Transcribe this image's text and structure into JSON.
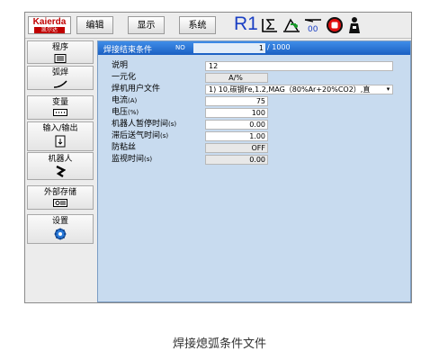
{
  "toolbar": {
    "logo_text": "Kaierda",
    "logo_sub": "凯尔达",
    "buttons": [
      "编辑",
      "显示",
      "系统"
    ],
    "robot_id": "R1",
    "icons": [
      "sigma-axis-icon",
      "arc-weld-icon",
      "percent-override-icon",
      "stop-icon",
      "person-icon"
    ]
  },
  "sidebar": {
    "items": [
      {
        "label": "程序",
        "icon": "program-icon"
      },
      {
        "label": "弧焊",
        "icon": "arc-icon"
      },
      {
        "label": "变量",
        "icon": "variable-icon"
      },
      {
        "label": "输入/输出",
        "icon": "io-icon"
      },
      {
        "label": "机器人",
        "icon": "robot-icon"
      },
      {
        "label": "外部存储",
        "icon": "storage-icon"
      },
      {
        "label": "设置",
        "icon": "settings-icon"
      }
    ]
  },
  "panel": {
    "title": "焊接结束条件",
    "no_label": "NO",
    "current_no": "1",
    "total": "/ 1000",
    "fields": [
      {
        "label": "说明",
        "unit": "",
        "value": "12"
      },
      {
        "label": "一元化",
        "unit": "",
        "value": "A/%"
      },
      {
        "label": "焊机用户文件",
        "unit": "",
        "value": "1) 10,碳钢Fe,1.2,MAG（80%Ar+20%CO2）,直"
      },
      {
        "label": "电流",
        "unit": "(A)",
        "value": "75"
      },
      {
        "label": "电压",
        "unit": "(%)",
        "value": "100"
      },
      {
        "label": "机器人暂停时间",
        "unit": "(s)",
        "value": "0.00"
      },
      {
        "label": "滞后送气时间",
        "unit": "(s)",
        "value": "1.00"
      },
      {
        "label": "防粘丝",
        "unit": "",
        "value": "OFF"
      },
      {
        "label": "监视时间",
        "unit": "(s)",
        "value": "0.00"
      }
    ]
  },
  "caption": "焊接熄弧条件文件",
  "colors": {
    "brand": "#c00000",
    "title_bar": "#1a5fc2",
    "panel_bg": "#c8dbef",
    "robot_id": "#1a3fc4"
  }
}
